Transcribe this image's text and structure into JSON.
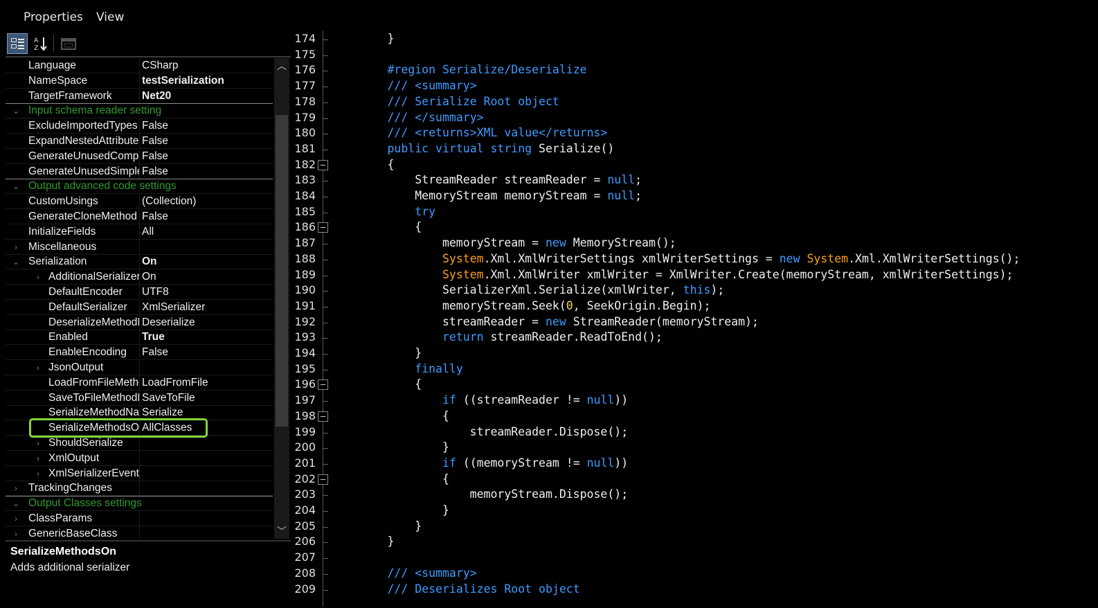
{
  "menu": [
    "Properties",
    "View"
  ],
  "toolbar": {
    "buttons": [
      {
        "icon": "categorized-icon",
        "active": true
      },
      {
        "icon": "alphabetical-icon",
        "active": false
      },
      {
        "icon": "property-pages-icon",
        "active": false
      }
    ]
  },
  "property_rows": [
    {
      "type": "prop",
      "name": "Language",
      "value": "CSharp",
      "bold": false,
      "level": 0
    },
    {
      "type": "prop",
      "name": "NameSpace",
      "value": "testSerialization",
      "bold": true,
      "level": 0
    },
    {
      "type": "prop",
      "name": "TargetFramework",
      "value": "Net20",
      "bold": true,
      "level": 0
    },
    {
      "type": "cat",
      "name": "Input schema reader setting"
    },
    {
      "type": "prop",
      "name": "ExcludeImportedTypes",
      "value": "False",
      "bold": false,
      "level": 0
    },
    {
      "type": "prop",
      "name": "ExpandNestedAttributes",
      "value": "False",
      "bold": false,
      "level": 0
    },
    {
      "type": "prop",
      "name": "GenerateUnusedComplexTypes",
      "value": "False",
      "bold": false,
      "level": 0
    },
    {
      "type": "prop",
      "name": "GenerateUnusedSimpleTypes",
      "value": "False",
      "bold": false,
      "level": 0
    },
    {
      "type": "cat",
      "name": "Output advanced code settings"
    },
    {
      "type": "prop",
      "name": "CustomUsings",
      "value": "(Collection)",
      "bold": false,
      "level": 0
    },
    {
      "type": "prop",
      "name": "GenerateCloneMethod",
      "value": "False",
      "bold": false,
      "level": 0
    },
    {
      "type": "prop",
      "name": "InitializeFields",
      "value": "All",
      "bold": false,
      "level": 0
    },
    {
      "type": "prop",
      "name": "Miscellaneous",
      "value": "",
      "bold": false,
      "level": 0,
      "expander": "collapsed"
    },
    {
      "type": "prop",
      "name": "Serialization",
      "value": "On",
      "bold": true,
      "level": 0,
      "expander": "expanded"
    },
    {
      "type": "prop",
      "name": "AdditionalSerializers",
      "value": "On",
      "bold": false,
      "level": 1,
      "expander": "collapsed"
    },
    {
      "type": "prop",
      "name": "DefaultEncoder",
      "value": "UTF8",
      "bold": false,
      "level": 1
    },
    {
      "type": "prop",
      "name": "DefaultSerializer",
      "value": "XmlSerializer",
      "bold": false,
      "level": 1
    },
    {
      "type": "prop",
      "name": "DeserializeMethodName",
      "value": "Deserialize",
      "bold": false,
      "level": 1
    },
    {
      "type": "prop",
      "name": "Enabled",
      "value": "True",
      "bold": true,
      "level": 1
    },
    {
      "type": "prop",
      "name": "EnableEncoding",
      "value": "False",
      "bold": false,
      "level": 1
    },
    {
      "type": "prop",
      "name": "JsonOutput",
      "value": "",
      "bold": false,
      "level": 1,
      "expander": "collapsed"
    },
    {
      "type": "prop",
      "name": "LoadFromFileMethodName",
      "value": "LoadFromFile",
      "bold": false,
      "level": 1
    },
    {
      "type": "prop",
      "name": "SaveToFileMethodName",
      "value": "SaveToFile",
      "bold": false,
      "level": 1
    },
    {
      "type": "prop",
      "name": "SerializeMethodName",
      "value": "Serialize",
      "bold": false,
      "level": 1
    },
    {
      "type": "prop",
      "name": "SerializeMethodsOn",
      "value": "AllClasses",
      "bold": false,
      "level": 1,
      "highlight": true
    },
    {
      "type": "prop",
      "name": "ShouldSerialize",
      "value": "",
      "bold": false,
      "level": 1,
      "expander": "collapsed"
    },
    {
      "type": "prop",
      "name": "XmlOutput",
      "value": "",
      "bold": false,
      "level": 1,
      "expander": "collapsed"
    },
    {
      "type": "prop",
      "name": "XmlSerializerEvent",
      "value": "",
      "bold": false,
      "level": 1,
      "expander": "collapsed"
    },
    {
      "type": "prop",
      "name": "TrackingChanges",
      "value": "",
      "bold": false,
      "level": 0,
      "expander": "collapsed"
    },
    {
      "type": "cat",
      "name": "Output Classes settings"
    },
    {
      "type": "prop",
      "name": "ClassParams",
      "value": "",
      "bold": false,
      "level": 0,
      "expander": "collapsed"
    },
    {
      "type": "prop",
      "name": "GenericBaseClass",
      "value": "",
      "bold": false,
      "level": 0,
      "expander": "collapsed"
    }
  ],
  "description": {
    "title": "SerializeMethodsOn",
    "text": "Adds additional serializer"
  },
  "colors": {
    "category_text": "#2f9a2f",
    "highlight_border": "#86d43c",
    "keyword": "#3f9bff",
    "type": "#ff9e1b",
    "number": "#f2d15a"
  },
  "code_lines": [
    {
      "n": "174",
      "fold": false,
      "tokens": [
        [
          "t",
          "        }"
        ]
      ]
    },
    {
      "n": "175",
      "fold": false,
      "tokens": [
        [
          "t",
          ""
        ]
      ]
    },
    {
      "n": "176",
      "fold": false,
      "tokens": [
        [
          "t",
          "        "
        ],
        [
          "c",
          "#region Serialize/Deserialize"
        ]
      ]
    },
    {
      "n": "177",
      "fold": false,
      "tokens": [
        [
          "t",
          "        "
        ],
        [
          "c",
          "/// <summary>"
        ]
      ]
    },
    {
      "n": "178",
      "fold": false,
      "tokens": [
        [
          "t",
          "        "
        ],
        [
          "c",
          "/// Serialize Root object"
        ]
      ]
    },
    {
      "n": "179",
      "fold": false,
      "tokens": [
        [
          "t",
          "        "
        ],
        [
          "c",
          "/// </summary>"
        ]
      ]
    },
    {
      "n": "180",
      "fold": false,
      "tokens": [
        [
          "t",
          "        "
        ],
        [
          "c",
          "/// <returns>XML value</returns>"
        ]
      ]
    },
    {
      "n": "181",
      "fold": false,
      "tokens": [
        [
          "t",
          "        "
        ],
        [
          "k",
          "public virtual string"
        ],
        [
          "t",
          " Serialize()"
        ]
      ]
    },
    {
      "n": "182",
      "fold": true,
      "tokens": [
        [
          "t",
          "        {"
        ]
      ]
    },
    {
      "n": "183",
      "fold": false,
      "tokens": [
        [
          "t",
          "            StreamReader streamReader = "
        ],
        [
          "k",
          "null"
        ],
        [
          "t",
          ";"
        ]
      ]
    },
    {
      "n": "184",
      "fold": false,
      "tokens": [
        [
          "t",
          "            MemoryStream memoryStream = "
        ],
        [
          "k",
          "null"
        ],
        [
          "t",
          ";"
        ]
      ]
    },
    {
      "n": "185",
      "fold": false,
      "tokens": [
        [
          "t",
          "            "
        ],
        [
          "k",
          "try"
        ]
      ]
    },
    {
      "n": "186",
      "fold": true,
      "tokens": [
        [
          "t",
          "            {"
        ]
      ]
    },
    {
      "n": "187",
      "fold": false,
      "tokens": [
        [
          "t",
          "                memoryStream = "
        ],
        [
          "k",
          "new"
        ],
        [
          "t",
          " MemoryStream();"
        ]
      ]
    },
    {
      "n": "188",
      "fold": false,
      "tokens": [
        [
          "t",
          "                "
        ],
        [
          "y",
          "System"
        ],
        [
          "t",
          ".Xml.XmlWriterSettings xmlWriterSettings = "
        ],
        [
          "k",
          "new"
        ],
        [
          "t",
          " "
        ],
        [
          "y",
          "System"
        ],
        [
          "t",
          ".Xml.XmlWriterSettings();"
        ]
      ]
    },
    {
      "n": "189",
      "fold": false,
      "tokens": [
        [
          "t",
          "                "
        ],
        [
          "y",
          "System"
        ],
        [
          "t",
          ".Xml.XmlWriter xmlWriter = XmlWriter.Create(memoryStream, xmlWriterSettings);"
        ]
      ]
    },
    {
      "n": "190",
      "fold": false,
      "tokens": [
        [
          "t",
          "                SerializerXml.Serialize(xmlWriter, "
        ],
        [
          "k",
          "this"
        ],
        [
          "t",
          ");"
        ]
      ]
    },
    {
      "n": "191",
      "fold": false,
      "tokens": [
        [
          "t",
          "                memoryStream.Seek("
        ],
        [
          "n",
          "0"
        ],
        [
          "t",
          ", SeekOrigin.Begin);"
        ]
      ]
    },
    {
      "n": "192",
      "fold": false,
      "tokens": [
        [
          "t",
          "                streamReader = "
        ],
        [
          "k",
          "new"
        ],
        [
          "t",
          " StreamReader(memoryStream);"
        ]
      ]
    },
    {
      "n": "193",
      "fold": false,
      "tokens": [
        [
          "t",
          "                "
        ],
        [
          "k",
          "return"
        ],
        [
          "t",
          " streamReader.ReadToEnd();"
        ]
      ]
    },
    {
      "n": "194",
      "fold": false,
      "tokens": [
        [
          "t",
          "            }"
        ]
      ]
    },
    {
      "n": "195",
      "fold": false,
      "tokens": [
        [
          "t",
          "            "
        ],
        [
          "k",
          "finally"
        ]
      ]
    },
    {
      "n": "196",
      "fold": true,
      "tokens": [
        [
          "t",
          "            {"
        ]
      ]
    },
    {
      "n": "197",
      "fold": false,
      "tokens": [
        [
          "t",
          "                "
        ],
        [
          "k",
          "if"
        ],
        [
          "t",
          " ((streamReader != "
        ],
        [
          "k",
          "null"
        ],
        [
          "t",
          "))"
        ]
      ]
    },
    {
      "n": "198",
      "fold": true,
      "tokens": [
        [
          "t",
          "                {"
        ]
      ]
    },
    {
      "n": "199",
      "fold": false,
      "tokens": [
        [
          "t",
          "                    streamReader.Dispose();"
        ]
      ]
    },
    {
      "n": "200",
      "fold": false,
      "tokens": [
        [
          "t",
          "                }"
        ]
      ]
    },
    {
      "n": "201",
      "fold": false,
      "tokens": [
        [
          "t",
          "                "
        ],
        [
          "k",
          "if"
        ],
        [
          "t",
          " ((memoryStream != "
        ],
        [
          "k",
          "null"
        ],
        [
          "t",
          "))"
        ]
      ]
    },
    {
      "n": "202",
      "fold": true,
      "tokens": [
        [
          "t",
          "                {"
        ]
      ]
    },
    {
      "n": "203",
      "fold": false,
      "tokens": [
        [
          "t",
          "                    memoryStream.Dispose();"
        ]
      ]
    },
    {
      "n": "204",
      "fold": false,
      "tokens": [
        [
          "t",
          "                }"
        ]
      ]
    },
    {
      "n": "205",
      "fold": false,
      "tokens": [
        [
          "t",
          "            }"
        ]
      ]
    },
    {
      "n": "206",
      "fold": false,
      "tokens": [
        [
          "t",
          "        }"
        ]
      ]
    },
    {
      "n": "207",
      "fold": false,
      "tokens": [
        [
          "t",
          ""
        ]
      ]
    },
    {
      "n": "208",
      "fold": false,
      "tokens": [
        [
          "t",
          "        "
        ],
        [
          "c",
          "/// <summary>"
        ]
      ]
    },
    {
      "n": "209",
      "fold": false,
      "tokens": [
        [
          "t",
          "        "
        ],
        [
          "c",
          "/// Deserializes Root object"
        ]
      ]
    }
  ]
}
